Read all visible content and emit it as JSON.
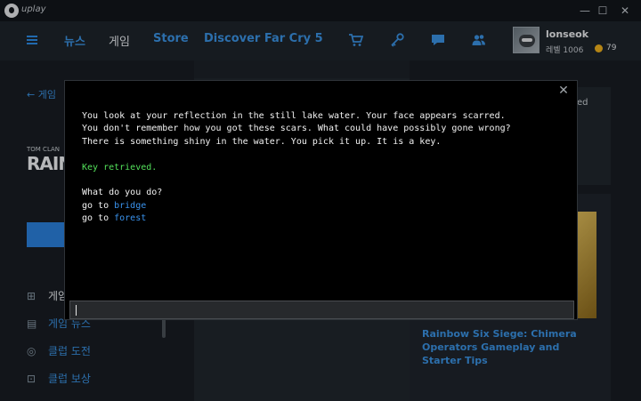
{
  "titlebar": {
    "app_name": "uplay",
    "min": "—",
    "max": "☐",
    "close": "✕"
  },
  "nav": {
    "links": [
      "뉴스",
      "게임",
      "Store",
      "Discover Far Cry 5"
    ],
    "active_index": 1,
    "user": {
      "name": "lonseok",
      "level": "레벨 1006",
      "coins": "79"
    }
  },
  "left": {
    "back_label": "게임",
    "publisher": "TOM CLAN",
    "game_title": "RAIN",
    "menu": [
      {
        "icon": "gamepad-icon",
        "label": "게임"
      },
      {
        "icon": "news-icon",
        "label": "게임 뉴스"
      },
      {
        "icon": "challenge-icon",
        "label": "클럽 도전"
      },
      {
        "icon": "gift-icon",
        "label": "클럽 보상"
      }
    ]
  },
  "right": {
    "clip_text": "ed",
    "news_title": "Rainbow Six Siege: Chimera Operators Gameplay and Starter Tips"
  },
  "terminal": {
    "lines": [
      "You look at your reflection in the still lake water. Your face appears scarred.",
      "You don't remember how you got these scars. What could have possibly gone wrong?",
      "There is something shiny in the water. You pick it up. It is a key."
    ],
    "status": "Key retrieved.",
    "prompt": "What do you do?",
    "choices": [
      {
        "prefix": "go to ",
        "target": "bridge"
      },
      {
        "prefix": "go to ",
        "target": "forest"
      }
    ],
    "input_value": ""
  },
  "colors": {
    "accent": "#3b94e6",
    "success": "#53e05a",
    "coin": "#f2b21c"
  }
}
